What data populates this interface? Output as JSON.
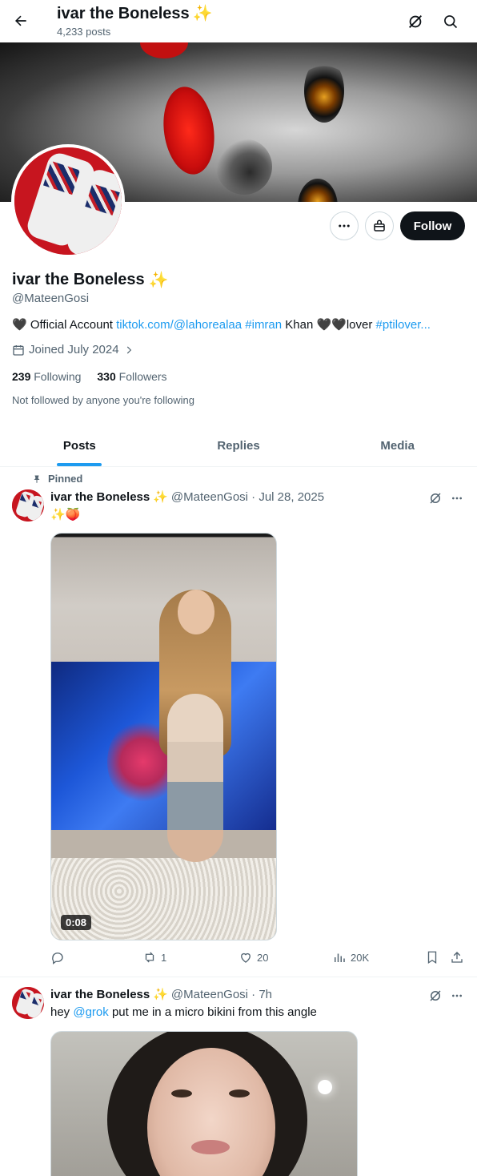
{
  "header": {
    "title": "ivar the Boneless",
    "title_emoji": "✨",
    "posts_count": "4,233 posts"
  },
  "profile": {
    "name": "ivar the Boneless",
    "name_emoji": "✨",
    "handle": "@MateenGosi",
    "bio": {
      "prefix": "🖤 Official Account ",
      "link1": "tiktok.com/@lahorealaa",
      "space1": " ",
      "hashtag1": "#imran",
      "middle": " Khan 🖤🖤lover ",
      "hashtag2": "#ptilover..."
    },
    "joined": "Joined July 2024",
    "following_count": "239",
    "following_label": "Following",
    "followers_count": "330",
    "followers_label": "Followers",
    "not_followed": "Not followed by anyone you're following",
    "follow_label": "Follow"
  },
  "tabs": [
    {
      "label": "Posts",
      "active": true
    },
    {
      "label": "Replies",
      "active": false
    },
    {
      "label": "Media",
      "active": false
    }
  ],
  "posts": [
    {
      "pinned_label": "Pinned",
      "name": "ivar the Boneless",
      "name_emoji": "✨",
      "meta": "@MateenGosi · Jul 28, 2025",
      "text": "✨🍑",
      "video_duration": "0:08",
      "replies": "",
      "reposts": "1",
      "likes": "20",
      "views": "20K"
    },
    {
      "name": "ivar the Boneless",
      "name_emoji": "✨",
      "meta": "@MateenGosi · 7h",
      "text_prefix": "hey ",
      "mention": "@grok",
      "text_suffix": " put me in a micro bikini from this angle"
    }
  ],
  "colors": {
    "accent": "#1d9bf0",
    "text_primary": "#0f1419",
    "text_secondary": "#536471",
    "follow_bg": "#0f1419"
  },
  "icons": {
    "back": "arrow-left-icon",
    "grok": "grok-icon",
    "search": "search-icon",
    "more": "more-icon",
    "subscribe": "gift-icon",
    "calendar": "calendar-icon",
    "pin": "pin-icon",
    "reply": "reply-icon",
    "repost": "repost-icon",
    "like": "heart-icon",
    "views": "views-icon",
    "bookmark": "bookmark-icon",
    "share": "share-icon"
  }
}
